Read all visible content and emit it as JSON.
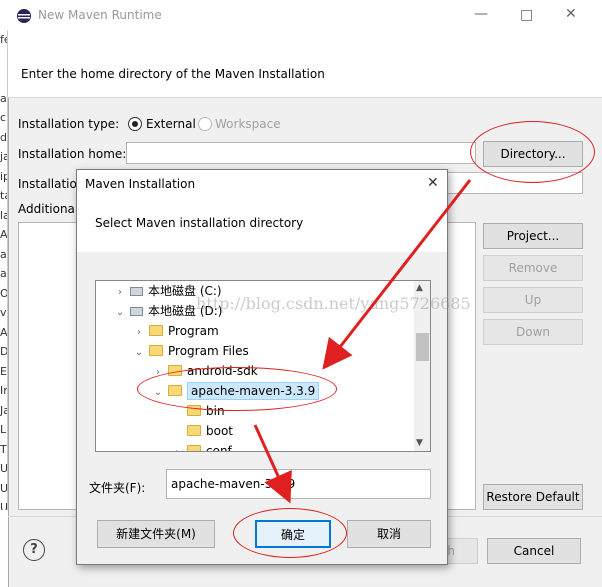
{
  "main_window": {
    "title": "New Maven Runtime",
    "header_text": "Enter the home directory of the Maven Installation",
    "installation_type_label": "Installation type:",
    "type_external": "External",
    "type_workspace": "Workspace",
    "installation_home_label": "Installation home:",
    "installation_home_value": "",
    "installation_name_label": "Installation",
    "additional_label": "Additional",
    "directory_button": "Directory...",
    "project_button": "Project...",
    "remove_button": "Remove",
    "up_button": "Up",
    "down_button": "Down",
    "restore_default_button": "Restore Default",
    "finish_button_partial": "h",
    "cancel_button": "Cancel",
    "help_icon_glyph": "?",
    "left_strip_fragments": [
      "fe",
      "",
      "",
      "al",
      "c",
      "de",
      "ja",
      "ip",
      "ta",
      "la",
      "A",
      "a",
      "a",
      "ON",
      "ve",
      "A",
      "D",
      "E",
      "In",
      "Ja",
      "Li",
      "T",
      "U",
      "U",
      "U",
      "lv"
    ]
  },
  "dialog": {
    "title": "Maven Installation",
    "prompt": "Select Maven installation directory",
    "tree": [
      {
        "label": "本地磁盘 (C:)",
        "icon": "drive-icon",
        "toggle": "›",
        "indent": 0
      },
      {
        "label": "本地磁盘 (D:)",
        "icon": "drive-icon",
        "toggle": "⌄",
        "indent": 0
      },
      {
        "label": "Program",
        "icon": "folder-icon",
        "toggle": "›",
        "indent": 1
      },
      {
        "label": "Program Files",
        "icon": "folder-icon",
        "toggle": "⌄",
        "indent": 1
      },
      {
        "label": "android-sdk",
        "icon": "folder-icon",
        "toggle": "›",
        "indent": 2
      },
      {
        "label": "apache-maven-3.3.9",
        "icon": "folder-icon",
        "toggle": "⌄",
        "indent": 2,
        "selected": true
      },
      {
        "label": "bin",
        "icon": "folder-icon",
        "toggle": "",
        "indent": 3
      },
      {
        "label": "boot",
        "icon": "folder-icon",
        "toggle": "",
        "indent": 3
      },
      {
        "label": "conf",
        "icon": "folder-icon",
        "toggle": "›",
        "indent": 3
      }
    ],
    "folder_label": "文件夹(F):",
    "folder_value": "apache-maven-3.3.9",
    "new_folder_button": "新建文件夹(M)",
    "ok_button": "确定",
    "cancel_button": "取消"
  },
  "watermark": "http://blog.csdn.net/yang5726685",
  "colors": {
    "annotation_red": "#e02020",
    "selection": "#cce8ff"
  }
}
